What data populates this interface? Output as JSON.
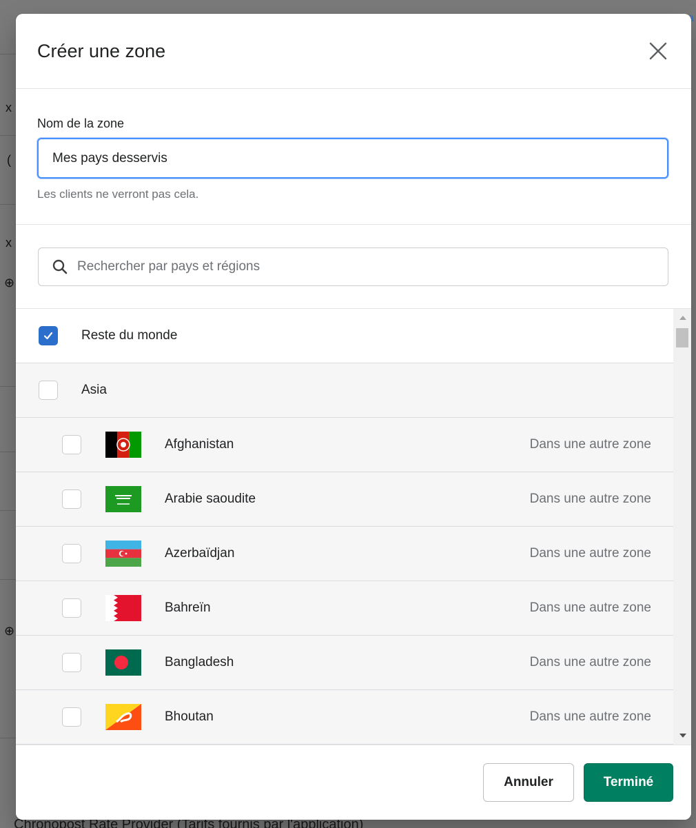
{
  "background": {
    "footer_text": "Chronopost Rate Provider (Tarifs fournis par l'application)",
    "link_fragment": "a"
  },
  "modal": {
    "title": "Créer une zone",
    "close_icon": "close-icon",
    "zone_name": {
      "label": "Nom de la zone",
      "value": "Mes pays desservis",
      "help": "Les clients ne verront pas cela."
    },
    "search": {
      "placeholder": "Rechercher par pays et régions",
      "icon": "search-icon"
    },
    "list": [
      {
        "type": "top",
        "label": "Reste du monde",
        "checked": true
      },
      {
        "type": "region",
        "label": "Asia",
        "checked": false
      },
      {
        "type": "country",
        "label": "Afghanistan",
        "status": "Dans une autre zone",
        "flag": "afghanistan-flag-icon",
        "checked": false
      },
      {
        "type": "country",
        "label": "Arabie saoudite",
        "status": "Dans une autre zone",
        "flag": "saudi-arabia-flag-icon",
        "checked": false
      },
      {
        "type": "country",
        "label": "Azerbaïdjan",
        "status": "Dans une autre zone",
        "flag": "azerbaijan-flag-icon",
        "checked": false
      },
      {
        "type": "country",
        "label": "Bahreïn",
        "status": "Dans une autre zone",
        "flag": "bahrain-flag-icon",
        "checked": false
      },
      {
        "type": "country",
        "label": "Bangladesh",
        "status": "Dans une autre zone",
        "flag": "bangladesh-flag-icon",
        "checked": false
      },
      {
        "type": "country",
        "label": "Bhoutan",
        "status": "Dans une autre zone",
        "flag": "bhutan-flag-icon",
        "checked": false
      }
    ],
    "footer": {
      "cancel_label": "Annuler",
      "done_label": "Terminé"
    }
  },
  "colors": {
    "primary_button": "#008060",
    "checkbox_checked": "#2c6ecb",
    "input_focus": "#458fff"
  }
}
